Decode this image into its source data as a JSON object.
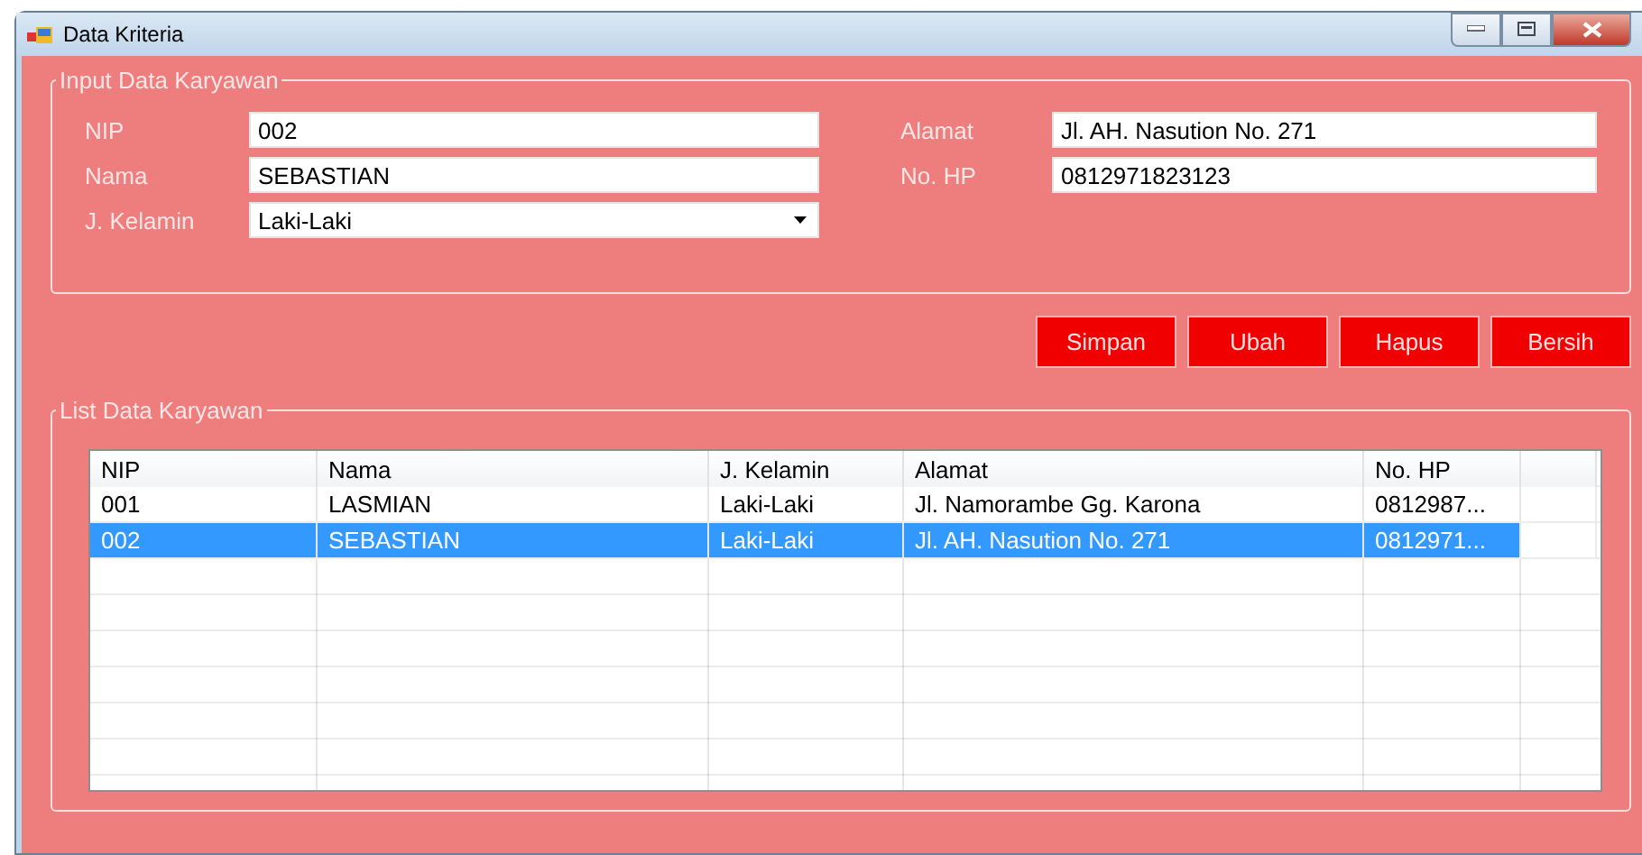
{
  "window": {
    "title": "Data Kriteria"
  },
  "input_group": {
    "title": "Input Data Karyawan",
    "left_fields": [
      {
        "label": "NIP",
        "value": "002",
        "kind": "text"
      },
      {
        "label": "Nama",
        "value": "SEBASTIAN",
        "kind": "text"
      },
      {
        "label": "J. Kelamin",
        "value": "Laki-Laki",
        "kind": "dropdown"
      }
    ],
    "right_fields": [
      {
        "label": "Alamat",
        "value": "Jl. AH. Nasution No. 271",
        "kind": "text"
      },
      {
        "label": "No. HP",
        "value": "0812971823123",
        "kind": "text"
      }
    ]
  },
  "buttons": [
    "Simpan",
    "Ubah",
    "Hapus",
    "Bersih"
  ],
  "list_group": {
    "title": "List Data Karyawan",
    "table": {
      "columns": [
        "NIP",
        "Nama",
        "J. Kelamin",
        "Alamat",
        "No. HP"
      ],
      "rows": [
        {
          "cells": [
            "001",
            "LASMIAN",
            "Laki-Laki",
            "Jl. Namorambe Gg. Karona",
            "0812987..."
          ],
          "selected": false
        },
        {
          "cells": [
            "002",
            "SEBASTIAN",
            "Laki-Laki",
            "Jl. AH. Nasution No. 271",
            "0812971..."
          ],
          "selected": true
        }
      ]
    }
  }
}
